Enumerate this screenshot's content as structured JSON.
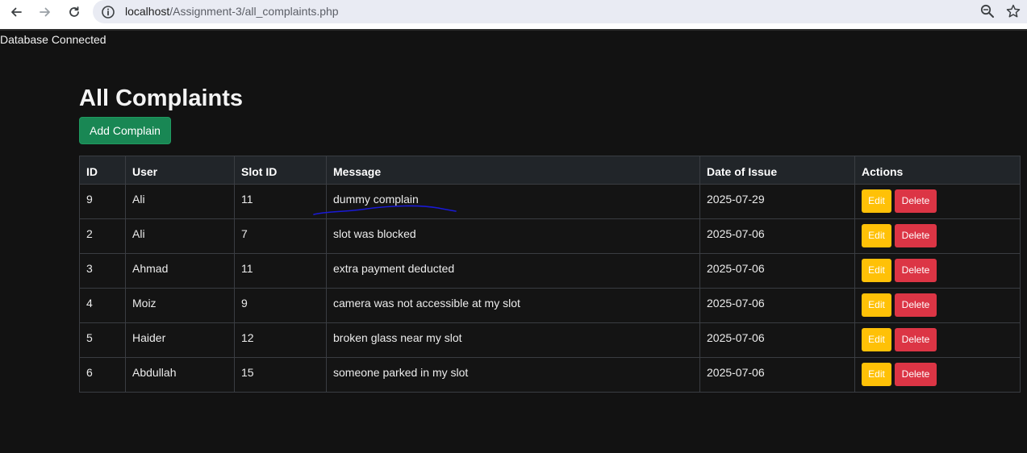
{
  "browser": {
    "url_host": "localhost",
    "url_path": "/Assignment-3/all_complaints.php"
  },
  "page": {
    "status_text": "Database Connected",
    "title": "All Complaints",
    "add_button_label": "Add Complain"
  },
  "table": {
    "headers": {
      "id": "ID",
      "user": "User",
      "slot_id": "Slot ID",
      "message": "Message",
      "date": "Date of Issue",
      "actions": "Actions"
    },
    "rows": [
      {
        "id": "9",
        "user": "Ali",
        "slot_id": "11",
        "message": "dummy complain",
        "date": "2025-07-29"
      },
      {
        "id": "2",
        "user": "Ali",
        "slot_id": "7",
        "message": "slot was blocked",
        "date": "2025-07-06"
      },
      {
        "id": "3",
        "user": "Ahmad",
        "slot_id": "11",
        "message": "extra payment deducted",
        "date": "2025-07-06"
      },
      {
        "id": "4",
        "user": "Moiz",
        "slot_id": "9",
        "message": "camera was not accessible at my slot",
        "date": "2025-07-06"
      },
      {
        "id": "5",
        "user": "Haider",
        "slot_id": "12",
        "message": "broken glass near my slot",
        "date": "2025-07-06"
      },
      {
        "id": "6",
        "user": "Abdullah",
        "slot_id": "15",
        "message": "someone parked in my slot",
        "date": "2025-07-06"
      }
    ],
    "edit_label": "Edit",
    "delete_label": "Delete"
  },
  "colors": {
    "page_background": "#121212",
    "success": "#198754",
    "warning": "#ffc107",
    "danger": "#dc3545",
    "ink_annotation": "#1a1ad6"
  },
  "icons": [
    "back-arrow-icon",
    "forward-arrow-icon",
    "reload-icon",
    "site-info-icon",
    "zoom-icon",
    "bookmark-star-icon"
  ]
}
